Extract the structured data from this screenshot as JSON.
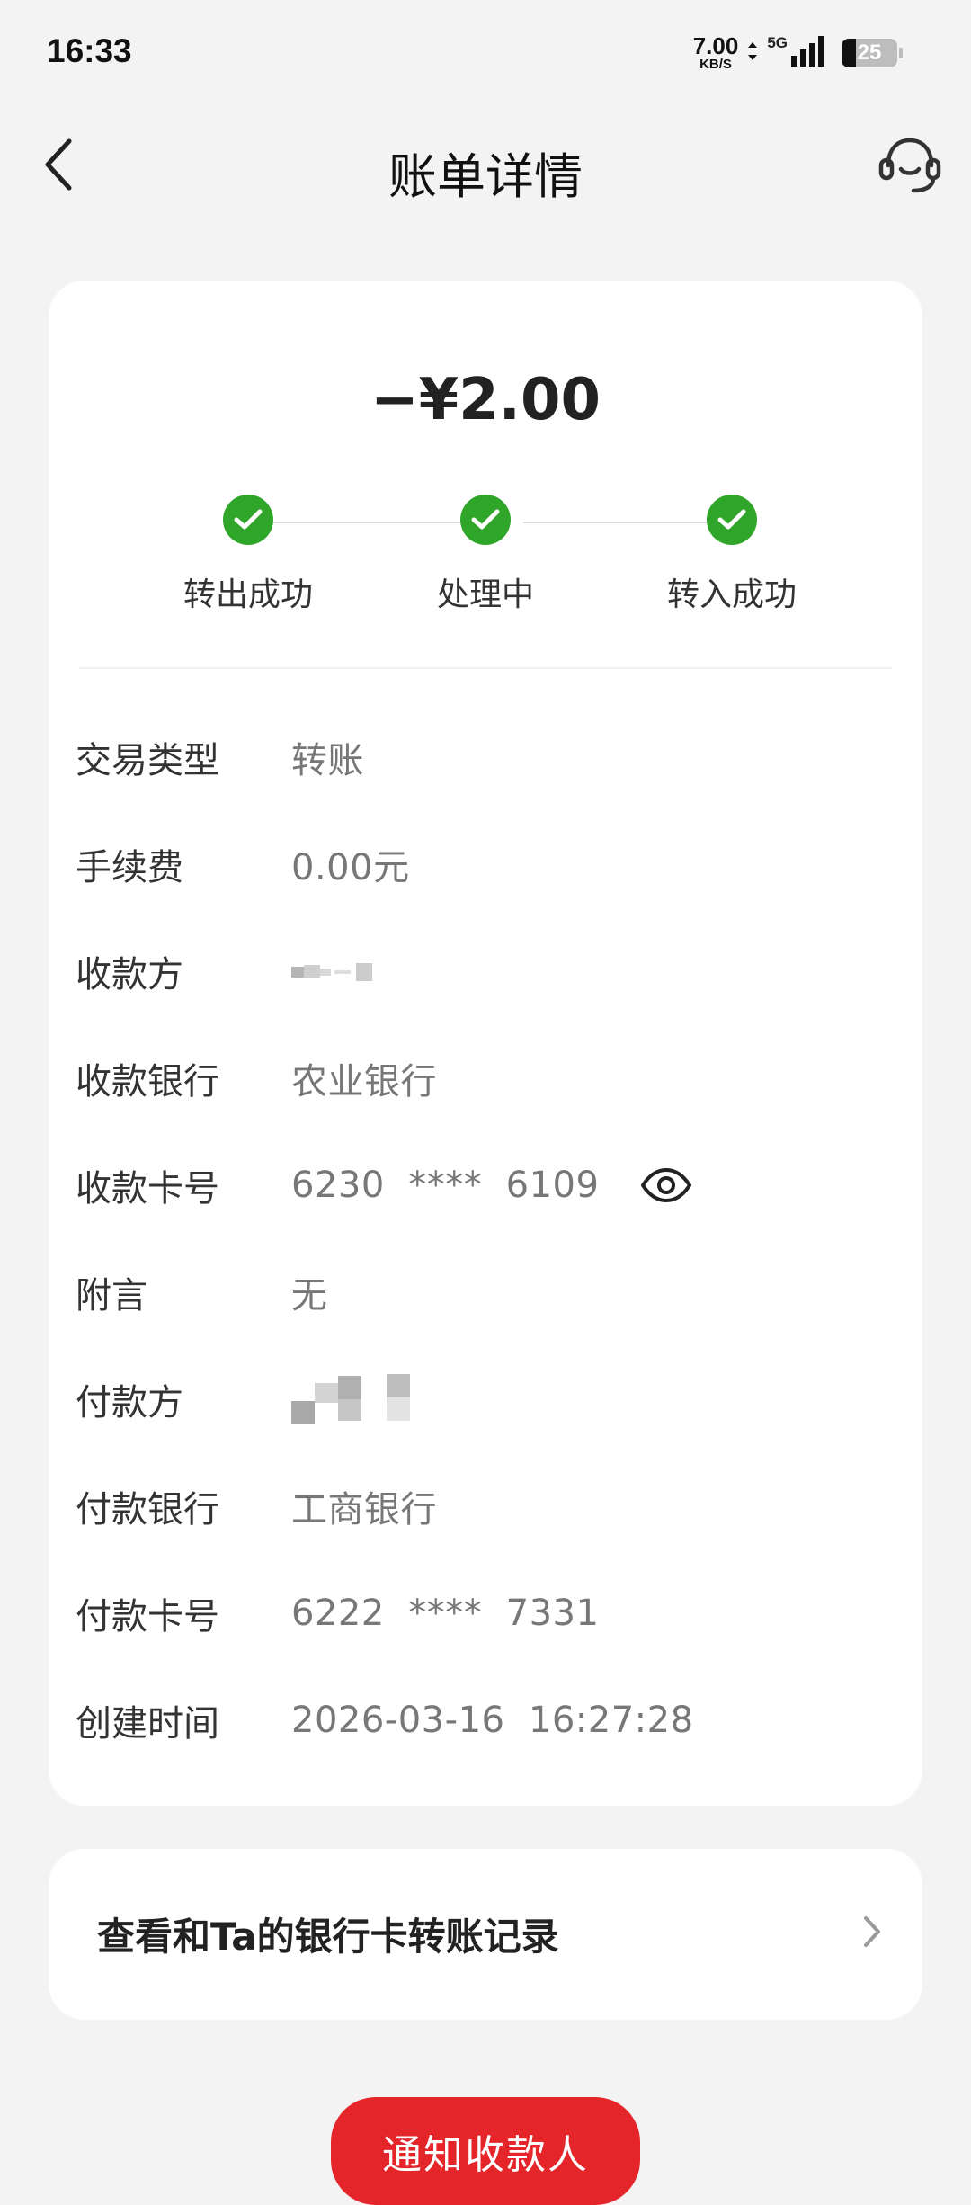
{
  "status_bar": {
    "time": "16:33",
    "net_speed_value": "7.00",
    "net_speed_unit": "KB/S",
    "network_type": "5G",
    "battery_level": "25",
    "battery_fraction": 0.25
  },
  "header": {
    "title": "账单详情",
    "back_icon": "chevron-left-icon",
    "service_icon": "headset-icon"
  },
  "summary": {
    "amount": "−¥2.00",
    "steps": [
      {
        "label": "转出成功",
        "status": "done"
      },
      {
        "label": "处理中",
        "status": "done"
      },
      {
        "label": "转入成功",
        "status": "done"
      }
    ],
    "step_color": "#2fa52a"
  },
  "details": [
    {
      "key": "交易类型",
      "value": "转账"
    },
    {
      "key": "手续费",
      "value": "0.00元"
    },
    {
      "key": "收款方",
      "value": ""
    },
    {
      "key": "收款银行",
      "value": "农业银行"
    },
    {
      "key": "收款卡号",
      "value": "6230  ****  6109"
    },
    {
      "key": "附言",
      "value": "无"
    },
    {
      "key": "付款方",
      "value": ""
    },
    {
      "key": "付款银行",
      "value": "工商银行"
    },
    {
      "key": "付款卡号",
      "value": "6222  ****  7331"
    },
    {
      "key": "创建时间",
      "value": "2026-03-16  16:27:28"
    }
  ],
  "record_link": {
    "label": "查看和Ta的银行卡转账记录"
  },
  "notify_button": {
    "label": "通知收款人",
    "color": "#e4262b"
  }
}
